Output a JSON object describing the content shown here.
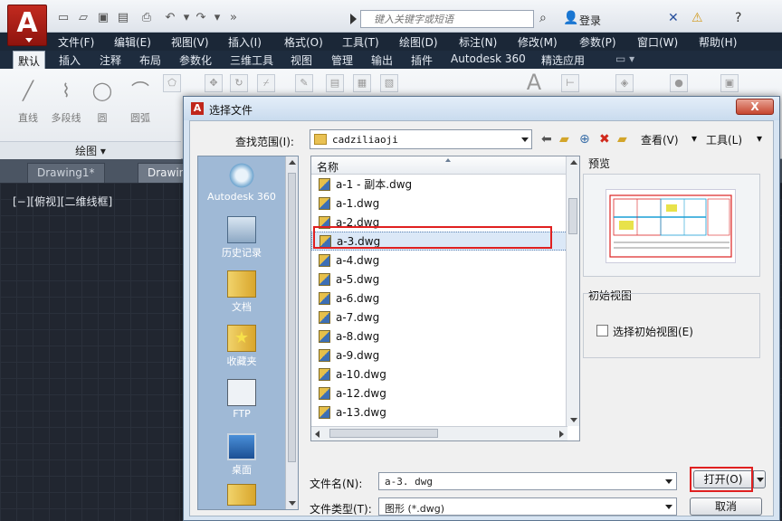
{
  "app": {
    "logo_letter": "A",
    "search_placeholder": "键入关键字或短语",
    "login": "登录"
  },
  "menu": [
    "文件(F)",
    "编辑(E)",
    "视图(V)",
    "插入(I)",
    "格式(O)",
    "工具(T)",
    "绘图(D)",
    "标注(N)",
    "修改(M)",
    "参数(P)",
    "窗口(W)",
    "帮助(H)"
  ],
  "ribbon_tabs": [
    "默认",
    "插入",
    "注释",
    "布局",
    "参数化",
    "三维工具",
    "视图",
    "管理",
    "输出",
    "插件",
    "Autodesk 360",
    "精选应用"
  ],
  "ribbon": {
    "draw_tools": [
      "直线",
      "多段线",
      "圆",
      "圆弧"
    ],
    "panel_label": "绘图 ▾"
  },
  "doc_tabs": [
    "Drawing1*",
    "Drawin"
  ],
  "viewport_label": "[−][俯视][二维线框]",
  "dialog": {
    "title": "选择文件",
    "close": "X",
    "lookin_label": "查找范围(I):",
    "lookin_value": "cadziliaoji",
    "views_label": "查看(V)",
    "tools_label": "工具(L)",
    "places": [
      "Autodesk 360",
      "历史记录",
      "文档",
      "收藏夹",
      "FTP",
      "桌面"
    ],
    "column_header": "名称",
    "files": [
      "a-1 - 副本.dwg",
      "a-1.dwg",
      "a-2.dwg",
      "a-3.dwg",
      "a-4.dwg",
      "a-5.dwg",
      "a-6.dwg",
      "a-7.dwg",
      "a-8.dwg",
      "a-9.dwg",
      "a-10.dwg",
      "a-12.dwg",
      "a-13.dwg"
    ],
    "selected_file": "a-3.dwg",
    "preview_label": "预览",
    "initial_view_label": "初始视图",
    "initial_view_checkbox": "选择初始视图(E)",
    "filename_label": "文件名(N):",
    "filename_value": "a-3. dwg",
    "filetype_label": "文件类型(T):",
    "filetype_value": "图形 (*.dwg)",
    "open_button": "打开(O)",
    "cancel_button": "取消"
  }
}
